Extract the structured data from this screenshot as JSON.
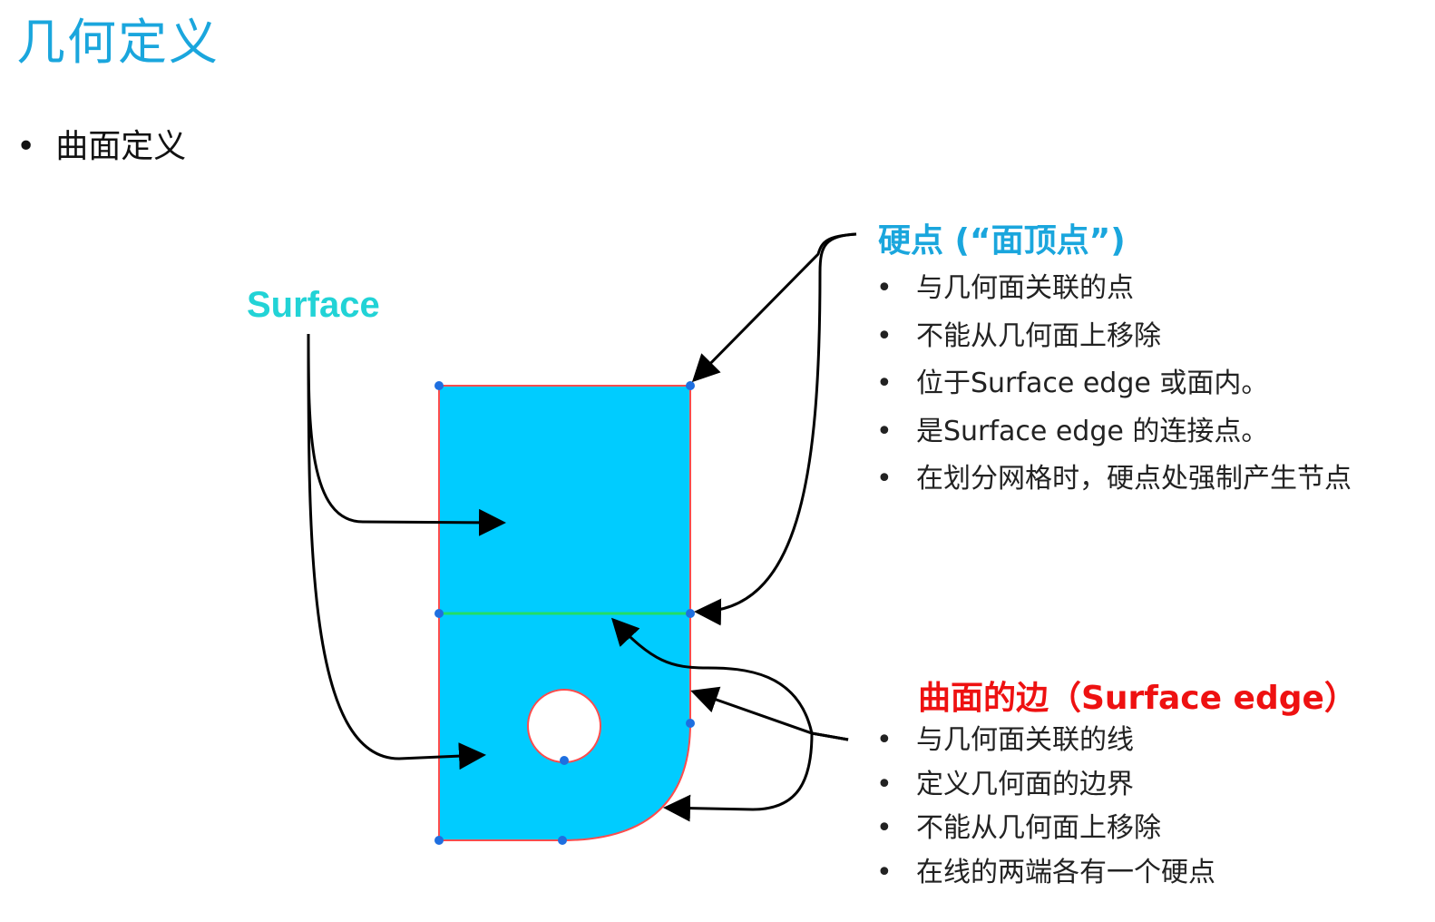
{
  "page": {
    "title": "几何定义",
    "bullet": "曲面定义"
  },
  "diagram": {
    "surface_label": "Surface",
    "hard_point": {
      "title": "硬点 (“面顶点”)",
      "items": [
        "与几何面关联的点",
        "不能从几何面上移除",
        "位于Surface edge 或面内。",
        "是Surface edge 的连接点。",
        "在划分网格时，硬点处强制产生节点"
      ]
    },
    "surface_edge": {
      "title": "曲面的边（Surface edge）",
      "items": [
        "与几何面关联的线",
        "定义几何面的边界",
        "不能从几何面上移除",
        "在线的两端各有一个硬点"
      ]
    },
    "colors": {
      "title": "#1aa6dd",
      "surface_label": "#22d3d6",
      "surface_fill": "#00ccff",
      "surface_edge_stroke": "#ff4d4d",
      "shared_edge": "#22dd66",
      "hard_point": "#1e6fe0",
      "edge_title": "#ee1111"
    }
  }
}
